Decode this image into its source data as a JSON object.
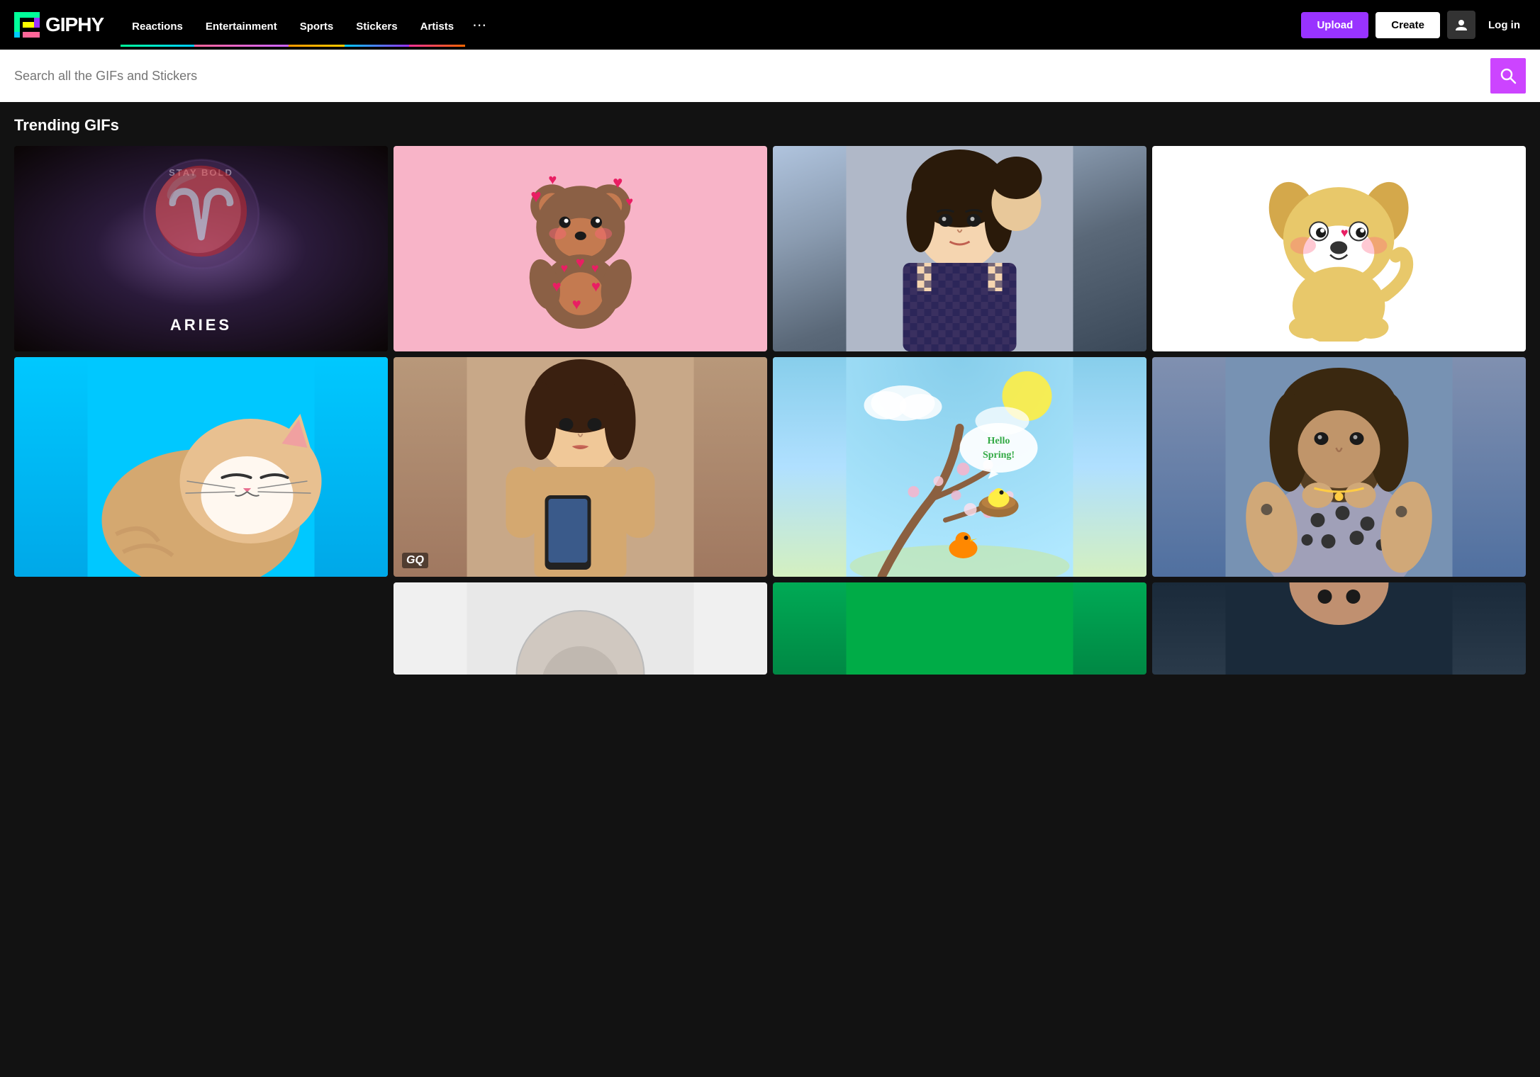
{
  "logo": {
    "text": "GIPHY"
  },
  "nav": {
    "links": [
      {
        "id": "reactions",
        "label": "Reactions",
        "class": "reactions"
      },
      {
        "id": "entertainment",
        "label": "Entertainment",
        "class": "entertainment"
      },
      {
        "id": "sports",
        "label": "Sports",
        "class": "sports"
      },
      {
        "id": "stickers",
        "label": "Stickers",
        "class": "stickers"
      },
      {
        "id": "artists",
        "label": "Artists",
        "class": "artists"
      }
    ],
    "more_icon": "•••",
    "upload_label": "Upload",
    "create_label": "Create",
    "login_label": "Log in"
  },
  "search": {
    "placeholder": "Search all the GIFs and Stickers"
  },
  "trending": {
    "title": "Trending GIFs"
  },
  "gifs": {
    "row1": [
      {
        "id": "aries",
        "label": "Aries Stay Bold",
        "top_text": "STAY BOLD",
        "bottom_text": "ARIES"
      },
      {
        "id": "bear",
        "label": "Bear with Hearts"
      },
      {
        "id": "girl",
        "label": "Girl Portrait"
      },
      {
        "id": "dog",
        "label": "Dog Cartoon"
      }
    ],
    "row2": [
      {
        "id": "cat",
        "label": "Sleeping Cat"
      },
      {
        "id": "woman",
        "label": "Woman with phone",
        "watermark": "GQ"
      },
      {
        "id": "spring",
        "label": "Hello Spring Bird"
      },
      {
        "id": "man",
        "label": "Man in polka dot shirt"
      }
    ],
    "row3": [
      {
        "id": "partial-bottom-left",
        "label": "Partial GIF bottom left"
      },
      {
        "id": "partial-bottom-right",
        "label": "Partial GIF bottom right"
      },
      {
        "id": "partial-green",
        "label": "Partial GIF green"
      }
    ]
  }
}
